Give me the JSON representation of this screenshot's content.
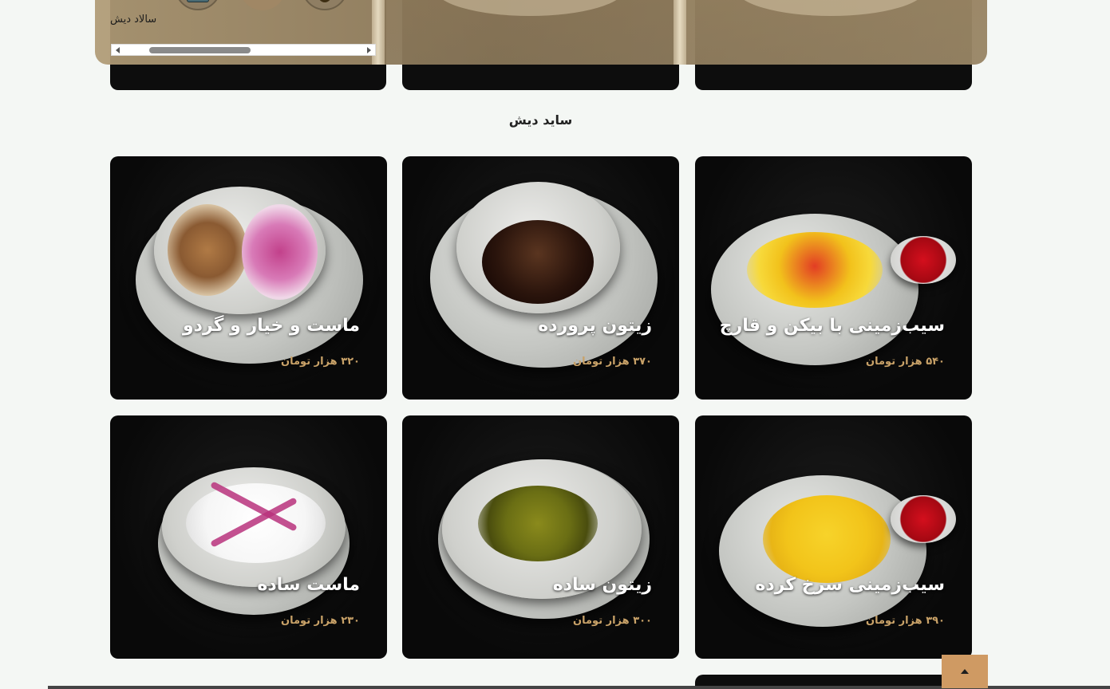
{
  "category_bar": {
    "active_label": "سالاد دیش",
    "categories": [
      {
        "icon": "plate-icon"
      },
      {
        "icon": "category-icon"
      },
      {
        "icon": "gear-badge-icon"
      }
    ]
  },
  "section": {
    "title": "ساید دیش"
  },
  "products": [
    {
      "name": "سیب‌زمینی با بیکن و قارچ",
      "price": "۵۴۰ هزار تومان",
      "dish": "fries-bacon"
    },
    {
      "name": "زیتون پرورده",
      "price": "۳۷۰ هزار تومان",
      "dish": "olive-parvardeh"
    },
    {
      "name": "ماست و خیار و گردو",
      "price": "۳۲۰ هزار تومان",
      "dish": "yogurt-walnut"
    },
    {
      "name": "سیب‌زمینی سرخ کرده",
      "price": "۳۹۰ هزار تومان",
      "dish": "fries"
    },
    {
      "name": "زیتون ساده",
      "price": "۳۰۰ هزار تومان",
      "dish": "olive-plain"
    },
    {
      "name": "ماست ساده",
      "price": "۲۳۰ هزار تومان",
      "dish": "yogurt-plain"
    }
  ],
  "colors": {
    "accent": "#cf9a63",
    "price": "#c9a268",
    "card_bg": "#0d0d0d",
    "page_bg": "#f4f7f4"
  }
}
